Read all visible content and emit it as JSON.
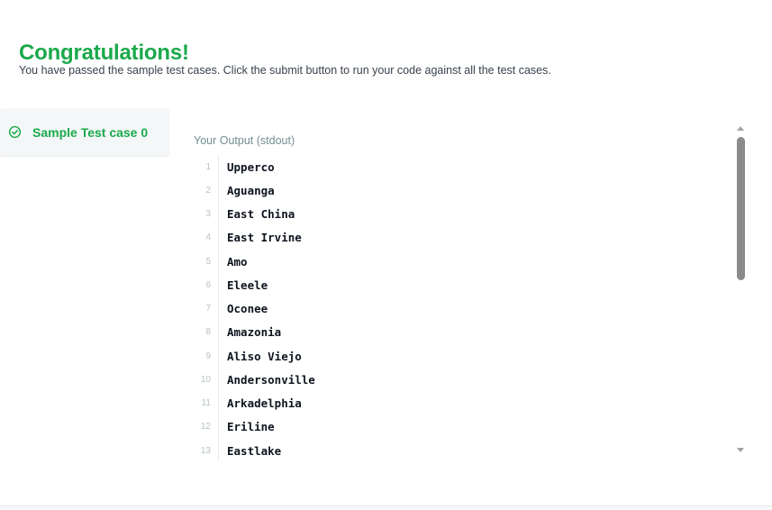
{
  "result": {
    "title": "Congratulations!",
    "message": "You have passed the sample test cases. Click the submit button to run your code against all the test cases."
  },
  "testcases": {
    "active_label": "Sample Test case 0"
  },
  "output": {
    "label": "Your Output (stdout)",
    "lines": [
      {
        "num": "1",
        "text": "Upperco"
      },
      {
        "num": "2",
        "text": "Aguanga"
      },
      {
        "num": "3",
        "text": "East China"
      },
      {
        "num": "4",
        "text": "East Irvine"
      },
      {
        "num": "5",
        "text": "Amo"
      },
      {
        "num": "6",
        "text": "Eleele"
      },
      {
        "num": "7",
        "text": "Oconee"
      },
      {
        "num": "8",
        "text": "Amazonia"
      },
      {
        "num": "9",
        "text": "Aliso Viejo"
      },
      {
        "num": "10",
        "text": "Andersonville"
      },
      {
        "num": "11",
        "text": "Arkadelphia"
      },
      {
        "num": "12",
        "text": "Eriline"
      },
      {
        "num": "13",
        "text": "Eastlake"
      }
    ]
  },
  "colors": {
    "success": "#1ba94c",
    "text": "#39424e",
    "muted": "#738f93"
  },
  "icons": {
    "testcase_status": "check-circle-icon"
  }
}
